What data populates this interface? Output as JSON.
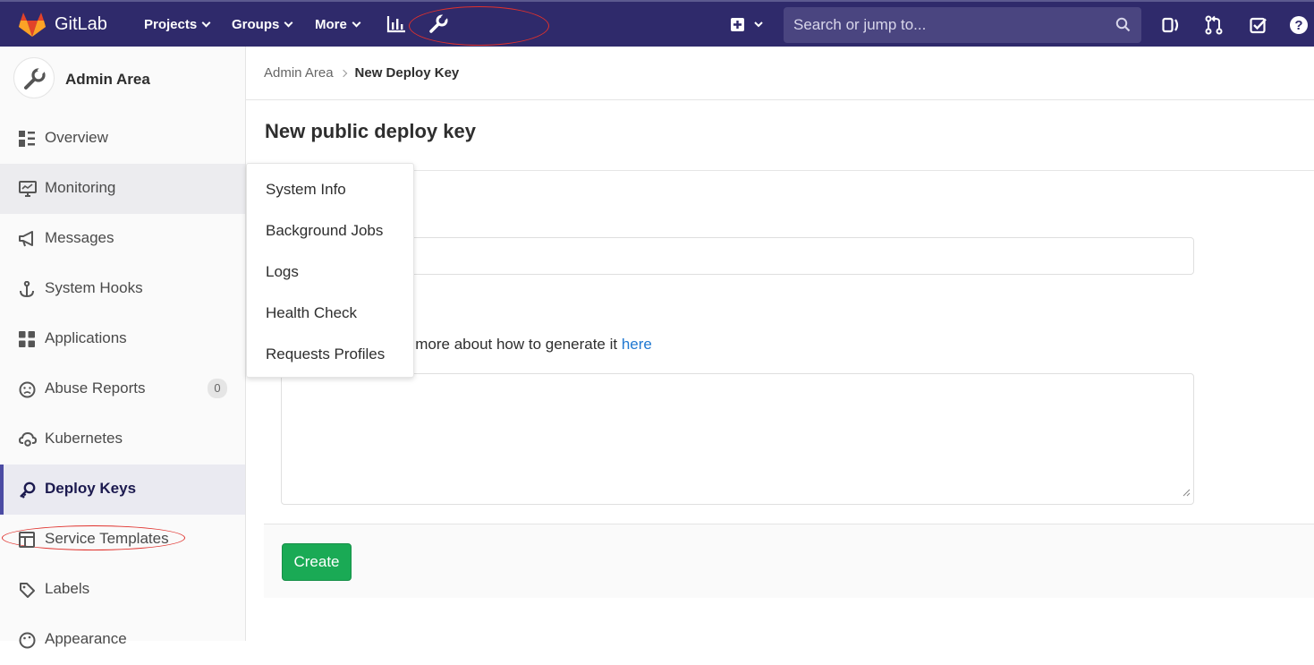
{
  "navbar": {
    "brand": "GitLab",
    "menus": [
      {
        "label": "Projects"
      },
      {
        "label": "Groups"
      },
      {
        "label": "More"
      }
    ],
    "search_placeholder": "Search or jump to..."
  },
  "sidebar": {
    "title": "Admin Area",
    "items": [
      {
        "label": "Overview",
        "icon": "overview-icon"
      },
      {
        "label": "Monitoring",
        "icon": "monitor-icon"
      },
      {
        "label": "Messages",
        "icon": "megaphone-icon"
      },
      {
        "label": "System Hooks",
        "icon": "anchor-icon"
      },
      {
        "label": "Applications",
        "icon": "apps-grid-icon"
      },
      {
        "label": "Abuse Reports",
        "icon": "frown-icon",
        "badge": "0"
      },
      {
        "label": "Kubernetes",
        "icon": "cloud-gear-icon"
      },
      {
        "label": "Deploy Keys",
        "icon": "key-icon"
      },
      {
        "label": "Service Templates",
        "icon": "template-icon"
      },
      {
        "label": "Labels",
        "icon": "label-icon"
      },
      {
        "label": "Appearance",
        "icon": "appearance-icon"
      }
    ]
  },
  "breadcrumb": {
    "root": "Admin Area",
    "current": "New Deploy Key"
  },
  "page_title": "New public deploy key",
  "form": {
    "key_help_text": "blic key here. Read more about how to generate it ",
    "key_help_link": "here",
    "create_label": "Create"
  },
  "monitoring_dropdown": {
    "items": [
      "System Info",
      "Background Jobs",
      "Logs",
      "Health Check",
      "Requests Profiles"
    ]
  },
  "colors": {
    "navbar": "#2f2a6b",
    "create_button": "#1aaa55",
    "link": "#1f78d1",
    "annotation": "#e0312c"
  }
}
